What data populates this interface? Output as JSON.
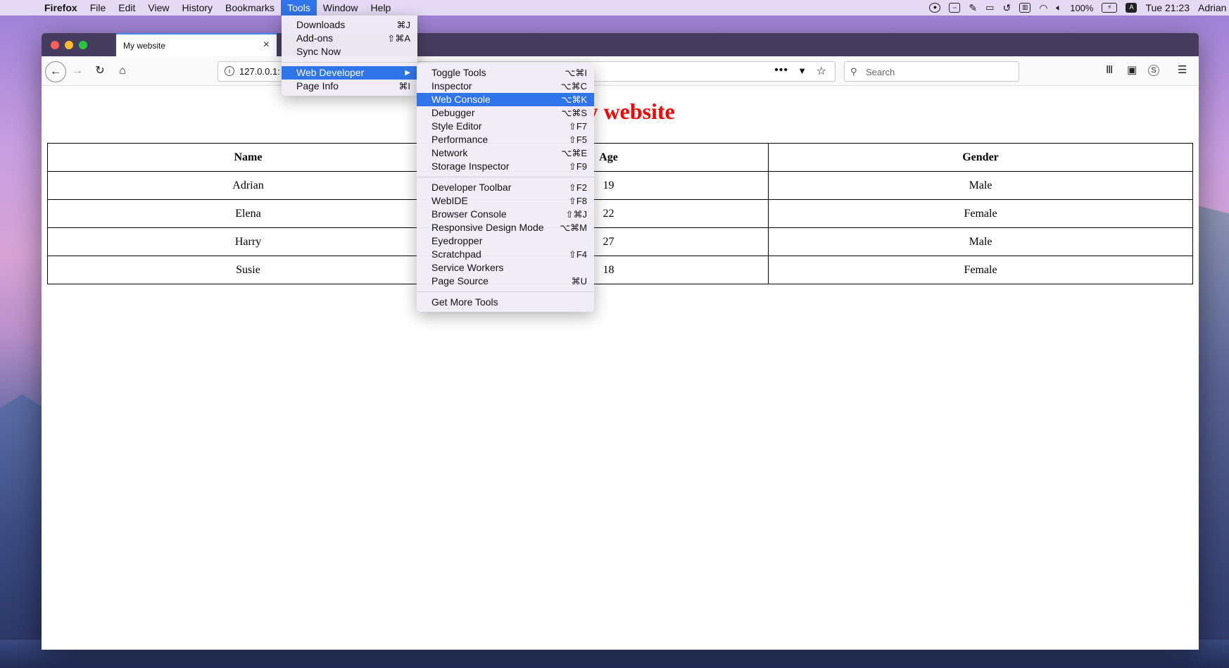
{
  "menubar": {
    "app_name": "Firefox",
    "items": [
      "File",
      "Edit",
      "View",
      "History",
      "Bookmarks",
      "Tools",
      "Window",
      "Help"
    ],
    "active_item": "Tools",
    "status": {
      "battery": "100%",
      "clock": "Tue 21:23",
      "user": "Adrian",
      "input_source": "A"
    }
  },
  "browser": {
    "tab_title": "My website",
    "url": "127.0.0.1:",
    "search_placeholder": "Search"
  },
  "page": {
    "title": "My website",
    "title_color": "#ff0000",
    "table": {
      "headers": [
        "Name",
        "Age",
        "Gender"
      ],
      "rows": [
        [
          "Adrian",
          "19",
          "Male"
        ],
        [
          "Elena",
          "22",
          "Female"
        ],
        [
          "Harry",
          "27",
          "Male"
        ],
        [
          "Susie",
          "18",
          "Female"
        ]
      ]
    }
  },
  "tools_menu": {
    "items": [
      {
        "label": "Downloads",
        "shortcut": "⌘J"
      },
      {
        "label": "Add-ons",
        "shortcut": "⇧⌘A"
      },
      {
        "label": "Sync Now",
        "shortcut": ""
      },
      {
        "label": "Web Developer",
        "shortcut": "▶",
        "selected": true
      },
      {
        "label": "Page Info",
        "shortcut": "⌘I"
      }
    ]
  },
  "webdev_menu": {
    "items": [
      {
        "label": "Toggle Tools",
        "shortcut": "⌥⌘I"
      },
      {
        "label": "Inspector",
        "shortcut": "⌥⌘C"
      },
      {
        "label": "Web Console",
        "shortcut": "⌥⌘K",
        "selected": true
      },
      {
        "label": "Debugger",
        "shortcut": "⌥⌘S"
      },
      {
        "label": "Style Editor",
        "shortcut": "⇧F7"
      },
      {
        "label": "Performance",
        "shortcut": "⇧F5"
      },
      {
        "label": "Network",
        "shortcut": "⌥⌘E"
      },
      {
        "label": "Storage Inspector",
        "shortcut": "⇧F9"
      },
      {
        "label": "Developer Toolbar",
        "shortcut": "⇧F2"
      },
      {
        "label": "WebIDE",
        "shortcut": "⇧F8"
      },
      {
        "label": "Browser Console",
        "shortcut": "⇧⌘J"
      },
      {
        "label": "Responsive Design Mode",
        "shortcut": "⌥⌘M"
      },
      {
        "label": "Eyedropper",
        "shortcut": ""
      },
      {
        "label": "Scratchpad",
        "shortcut": "⇧F4"
      },
      {
        "label": "Service Workers",
        "shortcut": ""
      },
      {
        "label": "Page Source",
        "shortcut": "⌘U"
      },
      {
        "label": "Get More Tools",
        "shortcut": ""
      }
    ]
  },
  "colors": {
    "accent": "#2f74e8",
    "tabbar": "#463d5e"
  }
}
